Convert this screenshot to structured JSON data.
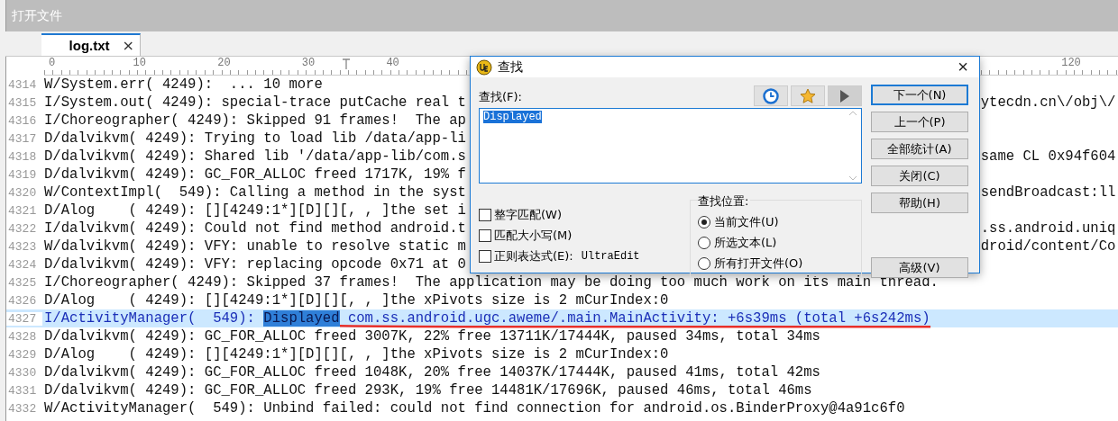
{
  "window": {
    "title": "打开文件"
  },
  "tabs": [
    {
      "label": "log.txt",
      "selected": true,
      "close": "×"
    }
  ],
  "ruler": {
    "labels": [
      "0",
      "10",
      "20",
      "30",
      "40",
      "120"
    ]
  },
  "editor": {
    "lines": [
      {
        "number": "4314",
        "text": "W/System.err( 4249):  ... 10 more"
      },
      {
        "number": "4315",
        "text": "I/System.out( 4249): special-trace putCache real t",
        "tail": "ytecdn.cn\\/obj\\/"
      },
      {
        "number": "4316",
        "text": "I/Choreographer( 4249): Skipped 91 frames!  The ap"
      },
      {
        "number": "4317",
        "text": "D/dalvikvm( 4249): Trying to load lib /data/app-li"
      },
      {
        "number": "4318",
        "text": "D/dalvikvm( 4249): Shared lib '/data/app-lib/com.s",
        "tail": "same CL 0x94f604"
      },
      {
        "number": "4319",
        "text": "D/dalvikvm( 4249): GC_FOR_ALLOC freed 1717K, 19% f"
      },
      {
        "number": "4320",
        "text": "W/ContextImpl(  549): Calling a method in the syst",
        "tail": "sendBroadcast:ll"
      },
      {
        "number": "4321",
        "text": "D/Alog    ( 4249): [][4249:1*][D][][, , ]the set i"
      },
      {
        "number": "4322",
        "text": "I/dalvikvm( 4249): Could not find method android.t",
        "tail": ".ss.android.uniq"
      },
      {
        "number": "4323",
        "text": "W/dalvikvm( 4249): VFY: unable to resolve static m",
        "tail": "droid/content/Co"
      },
      {
        "number": "4324",
        "text": "D/dalvikvm( 4249): VFY: replacing opcode 0x71 at 0"
      },
      {
        "number": "4325",
        "text": "I/Choreographer( 4249): Skipped 37 frames!  The application may be doing too much work on its main thread."
      },
      {
        "number": "4326",
        "text": "D/Alog    ( 4249): [][4249:1*][D][][, , ]the xPivots size is 2 mCurIndex:0"
      },
      {
        "number": "4327",
        "text": "I/ActivityManager(  549): ",
        "match": "Displayed",
        "after": " com.ss.android.ugc.aweme/.main.MainActivity: +6s39ms (total +6s242ms)",
        "selected": true,
        "underlined": true
      },
      {
        "number": "4328",
        "text": "D/dalvikvm( 4249): GC_FOR_ALLOC freed 3007K, 22% free 13711K/17444K, paused 34ms, total 34ms"
      },
      {
        "number": "4329",
        "text": "D/Alog    ( 4249): [][4249:1*][D][][, , ]the xPivots size is 2 mCurIndex:0"
      },
      {
        "number": "4330",
        "text": "D/dalvikvm( 4249): GC_FOR_ALLOC freed 1048K, 20% free 14037K/17444K, paused 41ms, total 42ms"
      },
      {
        "number": "4331",
        "text": "D/dalvikvm( 4249): GC_FOR_ALLOC freed 293K, 19% free 14481K/17696K, paused 46ms, total 46ms"
      },
      {
        "number": "4332",
        "text": "W/ActivityManager(  549): Unbind failed: could not find connection for android.os.BinderProxy@4a91c6f0"
      }
    ]
  },
  "find_dialog": {
    "title": "查找",
    "close": "×",
    "find_label": "查找(F):",
    "toolbar": [
      {
        "kind": "history",
        "disabled": false
      },
      {
        "kind": "favorite",
        "disabled": false
      },
      {
        "kind": "run",
        "disabled": true
      }
    ],
    "query": "Displayed",
    "query_selected": true,
    "options": [
      {
        "label": "整字匹配(W)",
        "checked": false
      },
      {
        "label": "匹配大小写(M)",
        "checked": false
      },
      {
        "label": "正则表达式(E):",
        "checked": false,
        "suffix": "UltraEdit"
      }
    ],
    "scope": {
      "title": "查找位置:",
      "items": [
        {
          "label": "当前文件(U)",
          "selected": true
        },
        {
          "label": "所选文本(L)",
          "selected": false
        },
        {
          "label": "所有打开文件(O)",
          "selected": false
        }
      ]
    },
    "buttons": [
      {
        "label": "下一个(N)",
        "default": true
      },
      {
        "label": "上一个(P)",
        "default": false
      },
      {
        "label": "全部统计(A)",
        "default": false
      },
      {
        "label": "关闭(C)",
        "default": false
      },
      {
        "label": "帮助(H)",
        "default": false
      }
    ],
    "advanced_button": "高级(V)"
  }
}
